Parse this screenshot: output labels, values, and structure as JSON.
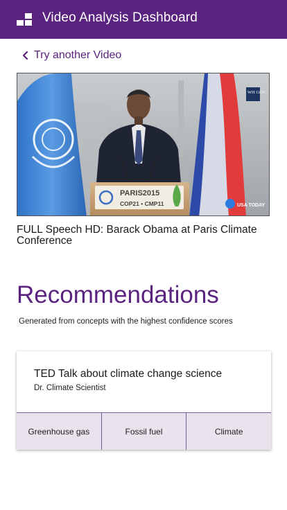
{
  "appbar": {
    "title": "Video Analysis Dashboard",
    "logo_icon": "dashboard-grid-icon",
    "background_color": "#5b2380"
  },
  "back_link": {
    "label": "Try another Video",
    "icon": "chevron-left-icon"
  },
  "video": {
    "title": "FULL Speech HD: Barack Obama at Paris Climate Conference",
    "podium_sign_line1": "PARIS2015",
    "podium_sign_line2": "COP21 • CMP11",
    "corner_logo": "WH GOV",
    "watermark": "USA TODAY"
  },
  "recommendations": {
    "heading": "Recommendations",
    "subtitle": "Generated from concepts with the highest confidence scores",
    "items": [
      {
        "title": "TED Talk about climate change science",
        "author": "Dr. Climate Scientist",
        "tags": [
          "Greenhouse gas",
          "Fossil fuel",
          "Climate"
        ]
      }
    ]
  },
  "colors": {
    "accent": "#5b2380",
    "tag_background": "#e9e3ee"
  }
}
